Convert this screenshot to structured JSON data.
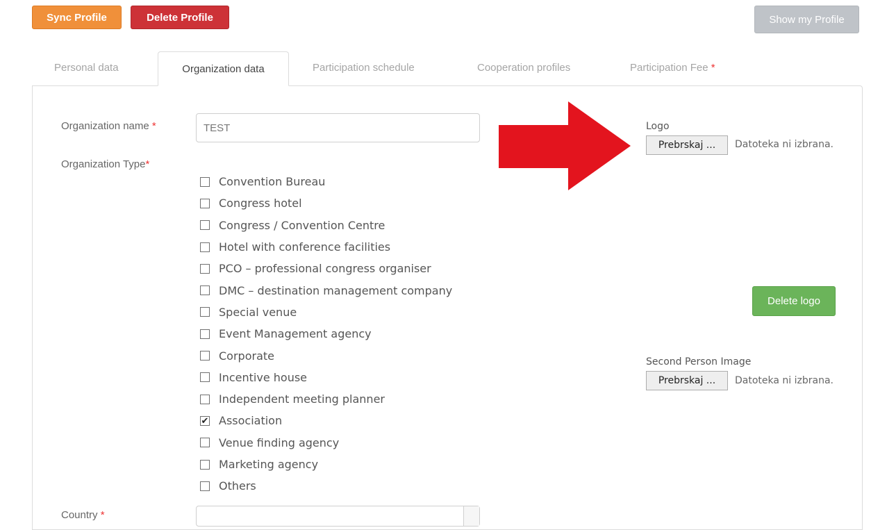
{
  "toolbar": {
    "sync_label": "Sync Profile",
    "delete_label": "Delete Profile",
    "show_label": "Show my Profile"
  },
  "tabs": [
    {
      "label": "Personal data",
      "active": false
    },
    {
      "label": "Organization data",
      "active": true
    },
    {
      "label": "Participation schedule",
      "active": false
    },
    {
      "label": "Cooperation profiles",
      "active": false
    },
    {
      "label": "Participation Fee",
      "active": false,
      "required_mark": "*"
    }
  ],
  "form": {
    "org_name_label": "Organization name",
    "org_name_value": "TEST",
    "org_type_label": "Organization Type",
    "required_mark": "*",
    "country_label": "Country",
    "org_types": [
      {
        "label": "Convention Bureau",
        "checked": false
      },
      {
        "label": "Congress hotel",
        "checked": false
      },
      {
        "label": "Congress / Convention Centre",
        "checked": false
      },
      {
        "label": "Hotel with conference facilities",
        "checked": false
      },
      {
        "label": "PCO – professional congress organiser",
        "checked": false
      },
      {
        "label": "DMC – destination management company",
        "checked": false
      },
      {
        "label": "Special venue",
        "checked": false
      },
      {
        "label": "Event Management agency",
        "checked": false
      },
      {
        "label": "Corporate",
        "checked": false
      },
      {
        "label": "Incentive house",
        "checked": false
      },
      {
        "label": "Independent meeting planner",
        "checked": false
      },
      {
        "label": "Association",
        "checked": true
      },
      {
        "label": "Venue finding agency",
        "checked": false
      },
      {
        "label": "Marketing agency",
        "checked": false
      },
      {
        "label": "Others",
        "checked": false
      }
    ],
    "checkmark_glyph": "✔"
  },
  "logo": {
    "label": "Logo",
    "browse_label": "Prebrskaj ...",
    "status": "Datoteka ni izbrana.",
    "delete_label": "Delete logo"
  },
  "second_image": {
    "label": "Second Person Image",
    "browse_label": "Prebrskaj ...",
    "status": "Datoteka ni izbrana."
  },
  "colors": {
    "sync": "#f0903a",
    "delete": "#cd3237",
    "show": "#bfc3c8",
    "delete_logo": "#6bb45a",
    "arrow": "#e3141e",
    "required": "#e33333"
  }
}
